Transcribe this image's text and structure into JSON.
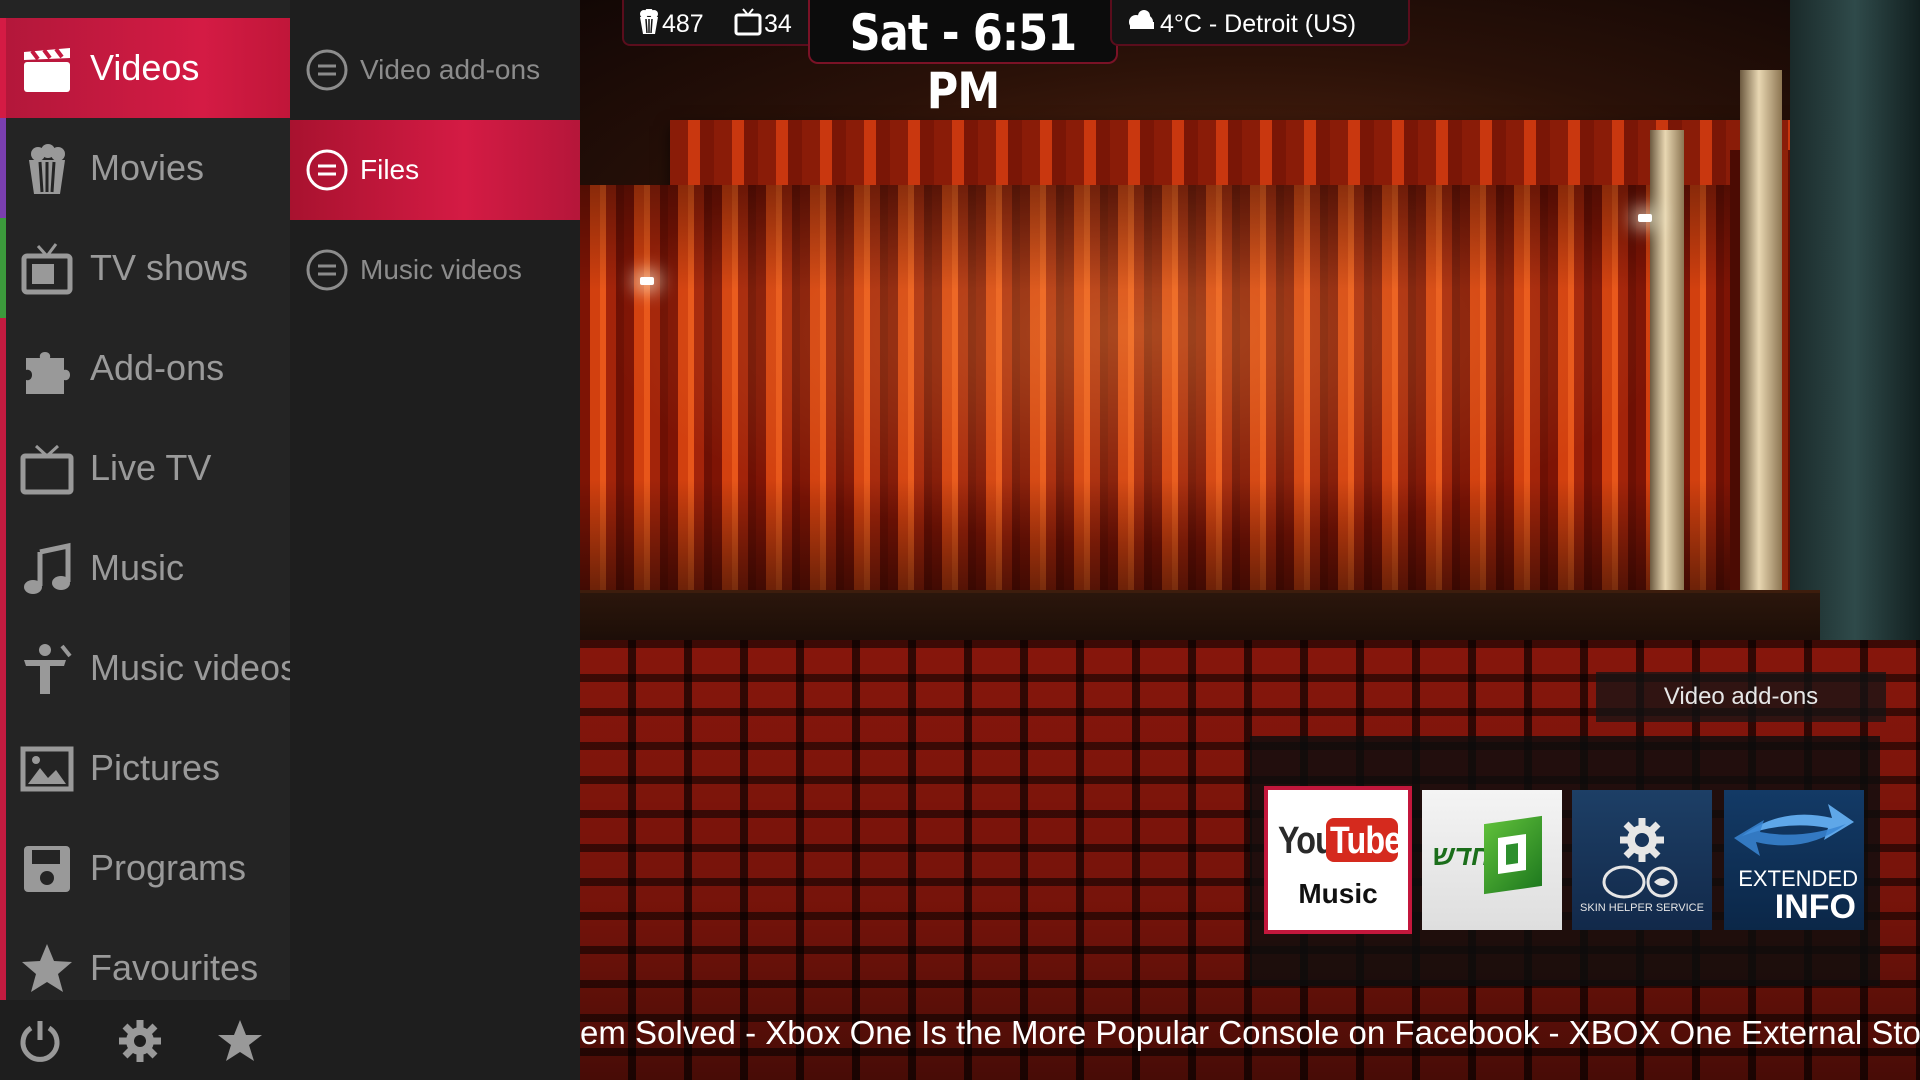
{
  "main_menu": {
    "items": [
      {
        "label": "Videos",
        "icon": "clapperboard-icon",
        "stripe": "#d41b44",
        "active": true
      },
      {
        "label": "Movies",
        "icon": "popcorn-icon",
        "stripe": "#7b3fb0"
      },
      {
        "label": "TV shows",
        "icon": "tv-icon",
        "stripe": "#3c9a3c"
      },
      {
        "label": "Add-ons",
        "icon": "puzzle-icon",
        "stripe": "#c31b40"
      },
      {
        "label": "Live TV",
        "icon": "live-tv-icon",
        "stripe": "#c31b40"
      },
      {
        "label": "Music",
        "icon": "music-note-icon",
        "stripe": "#c31b40"
      },
      {
        "label": "Music videos",
        "icon": "music-video-icon",
        "stripe": "#c31b40"
      },
      {
        "label": "Pictures",
        "icon": "pictures-icon",
        "stripe": "#c31b40"
      },
      {
        "label": "Programs",
        "icon": "floppy-disk-icon",
        "stripe": "#c31b40"
      },
      {
        "label": "Favourites",
        "icon": "star-icon",
        "stripe": "#c31b40"
      }
    ]
  },
  "bottom_bar": {
    "buttons": [
      {
        "name": "power-icon"
      },
      {
        "name": "gear-icon"
      },
      {
        "name": "star-icon"
      }
    ]
  },
  "sub_menu": {
    "items": [
      {
        "label": "Video add-ons",
        "icon": "menu-circle-icon"
      },
      {
        "label": "Files",
        "icon": "menu-circle-icon",
        "active": true
      },
      {
        "label": "Music videos",
        "icon": "menu-circle-icon"
      }
    ]
  },
  "header": {
    "movie_count": "487",
    "tvshow_count": "34",
    "clock": "Sat - 6:51 PM",
    "weather": "4°C - Detroit (US)"
  },
  "widget": {
    "title": "Video add-ons",
    "tiles": [
      {
        "name": "youtube-music-tile",
        "text_a": "You",
        "text_b": "Tube",
        "text_c": "Music",
        "focused": true
      },
      {
        "name": "hebrew-addon-tile",
        "text_a": "חדש"
      },
      {
        "name": "skin-helper-service-tile",
        "text_a": "SKIN HELPER SERVICE"
      },
      {
        "name": "extended-info-tile",
        "text_a": "EXTENDED",
        "text_b": "INFO"
      }
    ]
  },
  "ticker": {
    "text": "em Solved - Xbox One Is the More Popular Console on Facebook  - XBOX One External Stor"
  },
  "colors": {
    "accent": "#d41b44",
    "panel": "#242424",
    "submenu_panel": "#1e1e1e"
  }
}
